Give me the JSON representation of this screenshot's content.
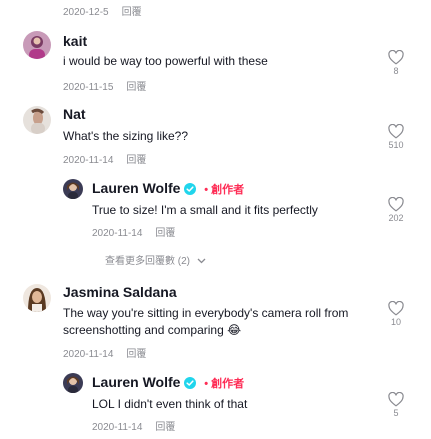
{
  "reply_label": "回覆",
  "comments": [
    {
      "date": "2020-12-5"
    },
    {
      "author": "kait",
      "text": "i would be way too powerful with these",
      "date": "2020-11-15",
      "likes": "8"
    },
    {
      "author": "Nat",
      "text": "What's the sizing like??",
      "date": "2020-11-14",
      "likes": "510",
      "replies": [
        {
          "author": "Lauren Wolfe",
          "creator_label": "創作者",
          "text": "True to size! I'm a small and it fits perfectly",
          "date": "2020-11-14",
          "likes": "202"
        }
      ],
      "more_replies": "查看更多回覆數 (2)"
    },
    {
      "author": "Jasmina Saldana",
      "text": "The way you're sitting in everybody's camera roll from screenshotting and comparing 😂",
      "date": "2020-11-14",
      "likes": "10",
      "replies": [
        {
          "author": "Lauren Wolfe",
          "creator_label": "創作者",
          "text": "LOL I didn't even think of that",
          "date": "2020-11-14",
          "likes": "5"
        }
      ]
    }
  ],
  "colors": {
    "creator": "#fe2c55",
    "verified": "#20d5ec",
    "meta": "#8a8b91"
  }
}
